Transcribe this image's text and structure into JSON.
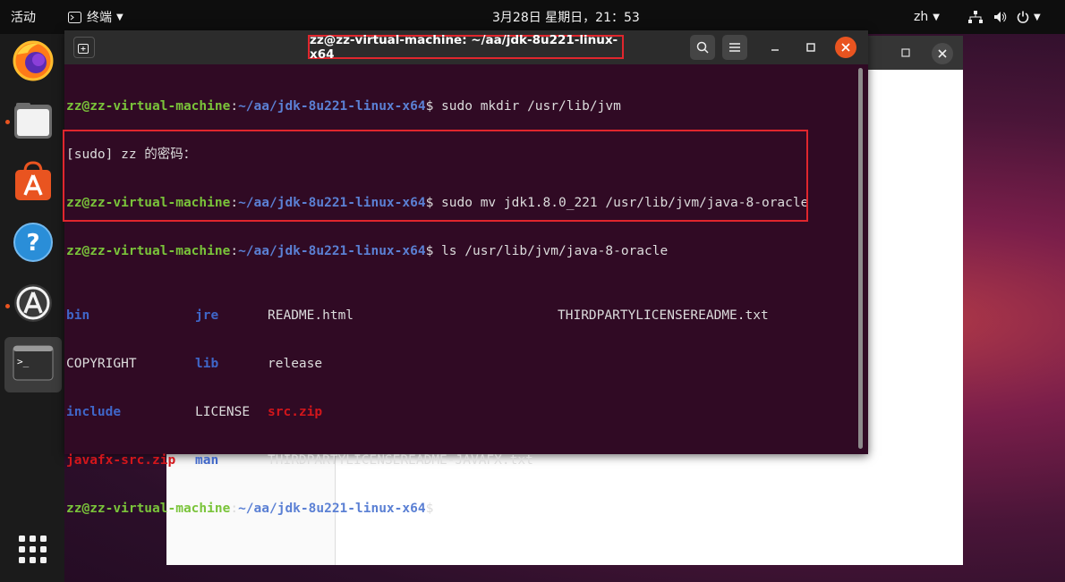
{
  "topbar": {
    "activities": "活动",
    "app_name": "终端",
    "clock": "3月28日 星期日，21：53",
    "lang": "zh"
  },
  "terminal": {
    "title": "zz@zz-virtual-machine: ~/aa/jdk-8u221-linux-x64",
    "prompt_user": "zz@zz-virtual-machine",
    "prompt_path": "~/aa/jdk-8u221-linux-x64",
    "commands": [
      "sudo mkdir /usr/lib/jvm",
      "sudo mv jdk1.8.0_221 /usr/lib/jvm/java-8-oracle",
      "ls /usr/lib/jvm/java-8-oracle"
    ],
    "sudo_prompt": "[sudo] zz 的密码：",
    "ls_rows": [
      [
        "bin",
        "jre",
        "README.html",
        "THIRDPARTYLICENSEREADME.txt"
      ],
      [
        "COPYRIGHT",
        "lib",
        "release",
        ""
      ],
      [
        "include",
        "LICENSE",
        "src.zip",
        ""
      ],
      [
        "javafx-src.zip",
        "man",
        "THIRDPARTYLICENSEREADME-JAVAFX.txt",
        ""
      ]
    ]
  },
  "colors": {
    "terminal_bg": "#300a24",
    "user_green": "#7ac43a",
    "path_blue": "#5b80d4",
    "dir_blue": "#3f66c8",
    "archive_red": "#d3161b",
    "highlight_red": "#e0262d",
    "ubuntu_orange": "#e95420"
  },
  "dock_icons": [
    "firefox-icon",
    "files-icon",
    "software-icon",
    "help-icon",
    "updater-icon",
    "terminal-icon",
    "app-grid-icon"
  ]
}
